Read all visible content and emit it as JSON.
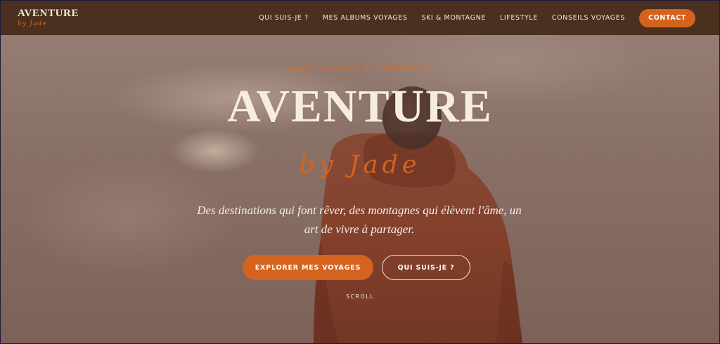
{
  "header": {
    "logo_title": "AVENTURE",
    "logo_sub": "by Jade",
    "nav": [
      {
        "label": "QUI SUIS-JE ?"
      },
      {
        "label": "MES ALBUMS VOYAGES"
      },
      {
        "label": "SKI & MONTAGNE"
      },
      {
        "label": "LIFESTYLE"
      },
      {
        "label": "CONSEILS VOYAGES"
      }
    ],
    "contact_label": "CONTACT"
  },
  "hero": {
    "eyebrow": "BLOG VOYAGE & LIFESTYLE",
    "title": "AVENTURE",
    "subtitle": "by Jade",
    "description": "Des destinations qui font rêver, des montagnes qui élèvent l'âme, un art de vivre à partager.",
    "primary_button": "EXPLORER MES VOYAGES",
    "secondary_button": "QUI SUIS-JE ?",
    "scroll_label": "SCROLL"
  },
  "colors": {
    "header_bg": "#4b2f1f",
    "accent": "#d4631f",
    "cream": "#f6eddd"
  }
}
